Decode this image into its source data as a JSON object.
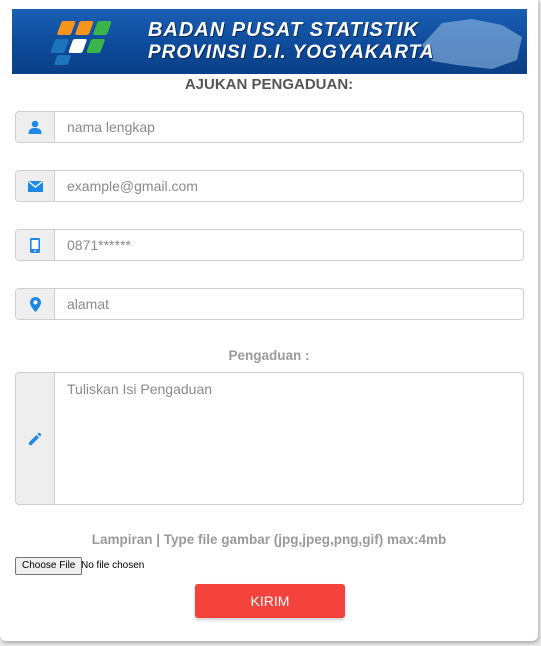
{
  "banner": {
    "line1": "BADAN PUSAT STATISTIK",
    "line2": "PROVINSI D.I. YOGYAKARTA"
  },
  "form": {
    "title": "AJUKAN PENGADUAN:",
    "name_placeholder": "nama lengkap",
    "email_placeholder": "example@gmail.com",
    "phone_placeholder": "0871******",
    "address_placeholder": "alamat",
    "complaint_label": "Pengaduan :",
    "complaint_placeholder": "Tuliskan Isi Pengaduan",
    "attachment_label": "Lampiran | Type file gambar (jpg,jpeg,png,gif) max:4mb",
    "file_button": "Choose File",
    "file_status": "No file chosen",
    "submit_label": "KIRIM"
  },
  "icons": {
    "name": "user-icon",
    "email": "envelope-icon",
    "phone": "mobile-phone-icon",
    "address": "map-marker-icon",
    "complaint": "pencil-icon"
  },
  "colors": {
    "accent": "#1e88e5",
    "submit": "#f4433c",
    "banner": "#1a5fb4"
  }
}
